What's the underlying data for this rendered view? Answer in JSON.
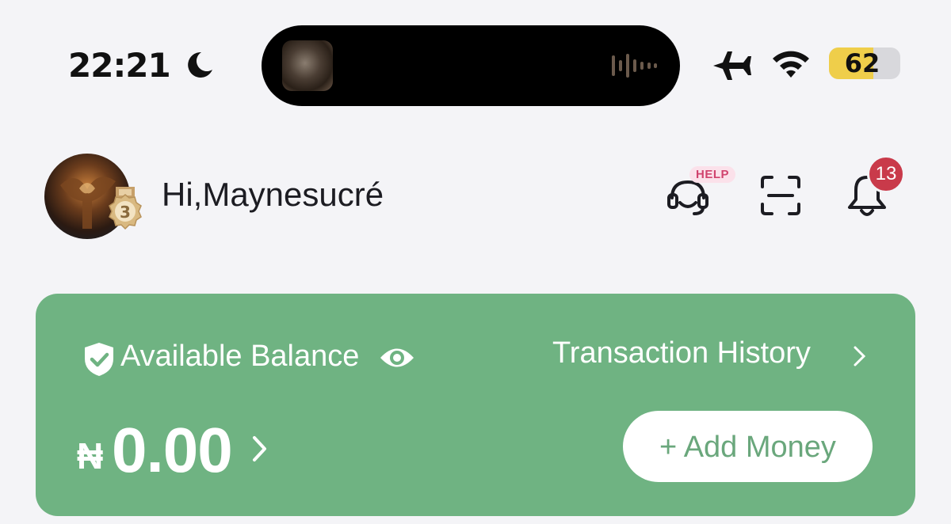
{
  "status_bar": {
    "time": "22:21",
    "focus_icon": "moon-icon",
    "airplane_icon": "airplane-icon",
    "wifi_icon": "wifi-icon",
    "battery_level": "62",
    "battery_fraction": 0.62,
    "battery_color": "#efce4a"
  },
  "header": {
    "greeting": "Hi,Maynesucré",
    "medal_level": "3",
    "help_badge": "HELP",
    "notification_count": "13"
  },
  "balance_card": {
    "background_color": "#6fb382",
    "label": "Available Balance",
    "transaction_history_label": "Transaction History",
    "currency_symbol": "₦",
    "amount": "0.00",
    "add_money_label": "+ Add Money"
  }
}
